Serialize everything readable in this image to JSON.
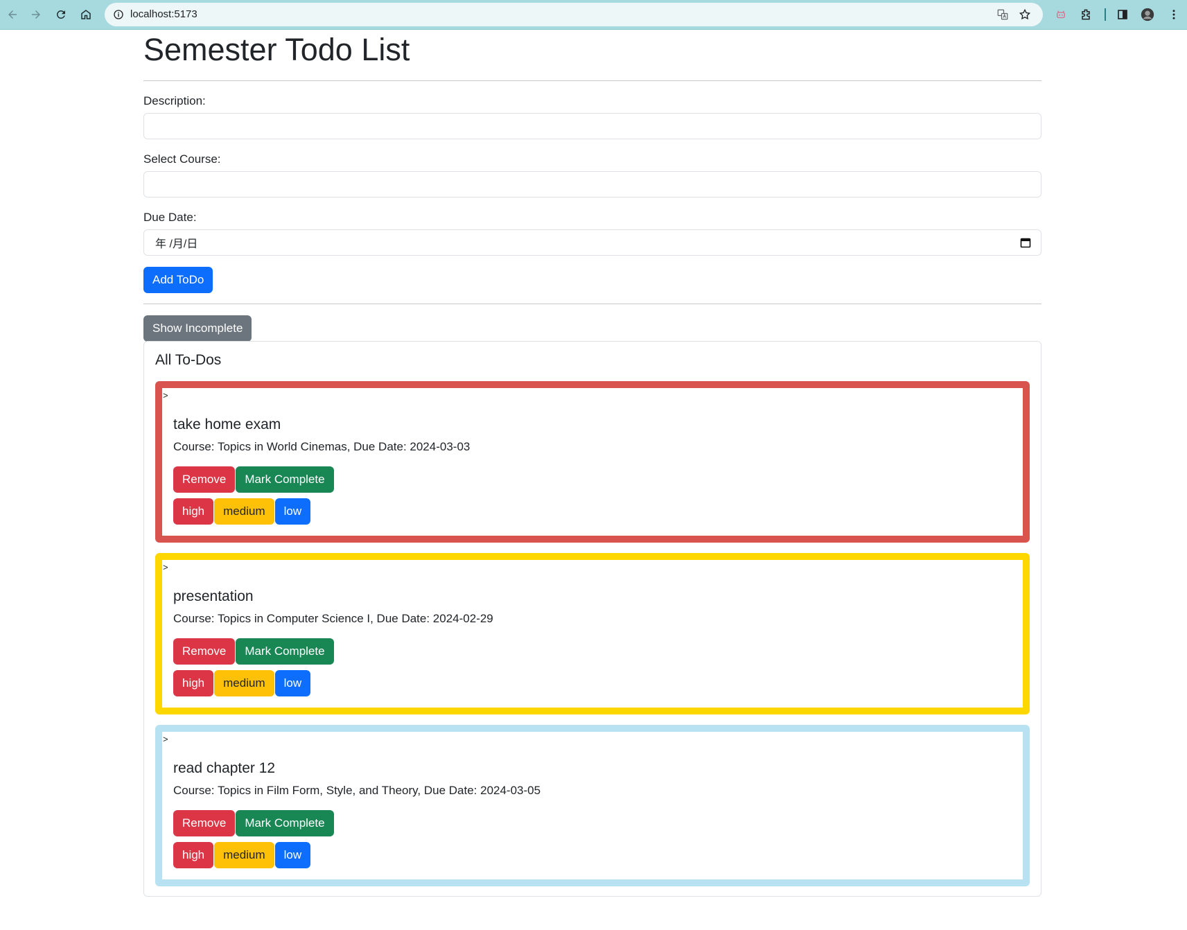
{
  "browser": {
    "url": "localhost:5173"
  },
  "page": {
    "title": "Semester Todo List",
    "form": {
      "description_label": "Description:",
      "description_value": "",
      "course_label": "Select Course:",
      "course_value": "",
      "due_date_label": "Due Date:",
      "due_date_placeholder": "年 /月/日",
      "add_button": "Add ToDo"
    },
    "filter_button": "Show Incomplete",
    "list": {
      "title": "All To-Dos",
      "items": [
        {
          "arrow": ">",
          "title": "take home exam",
          "meta": "Course: Topics in World Cinemas, Due Date: 2024-03-03",
          "border_color": "#d9534f",
          "remove": "Remove",
          "complete": "Mark Complete",
          "high": "high",
          "medium": "medium",
          "low": "low"
        },
        {
          "arrow": ">",
          "title": "presentation",
          "meta": "Course: Topics in Computer Science I, Due Date: 2024-02-29",
          "border_color": "#ffd700",
          "remove": "Remove",
          "complete": "Mark Complete",
          "high": "high",
          "medium": "medium",
          "low": "low"
        },
        {
          "arrow": ">",
          "title": "read chapter 12",
          "meta": "Course: Topics in Film Form, Style, and Theory, Due Date: 2024-03-05",
          "border_color": "#b8e2f2",
          "remove": "Remove",
          "complete": "Mark Complete",
          "high": "high",
          "medium": "medium",
          "low": "low"
        }
      ]
    }
  }
}
